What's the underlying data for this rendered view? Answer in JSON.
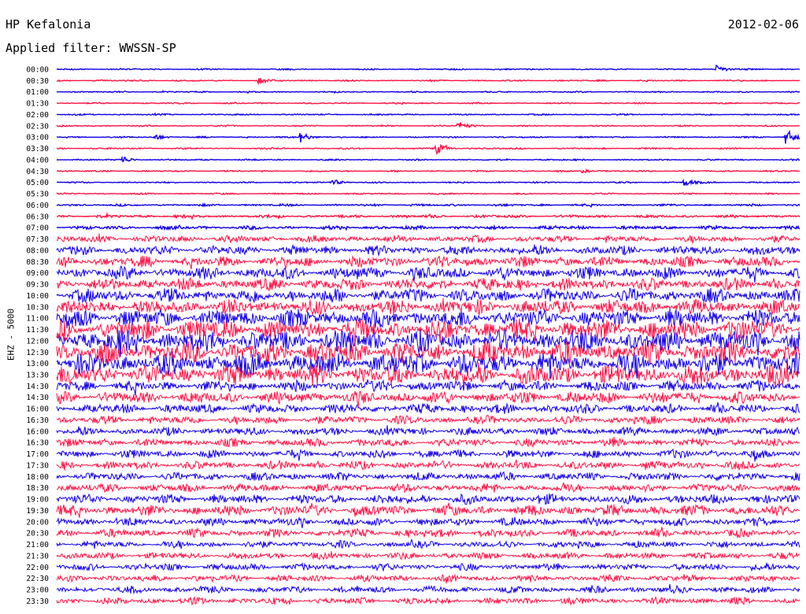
{
  "header": {
    "station": "HP Kefalonia",
    "date": "2012-02-06",
    "filter_label": "Applied filter: WWSSN-SP"
  },
  "colors": {
    "trace_a": "#1400e8",
    "trace_b": "#ff1447",
    "background": "#ffffff"
  },
  "chart_data": {
    "type": "line",
    "title": "HP Kefalonia",
    "ylabel": "EHZ - 5000",
    "xlabel": "",
    "y_tick_labels": [
      "00:00",
      "00:30",
      "01:00",
      "01:30",
      "02:00",
      "02:30",
      "03:00",
      "03:30",
      "04:00",
      "04:30",
      "05:00",
      "05:30",
      "06:00",
      "06:30",
      "07:00",
      "07:30",
      "08:00",
      "08:30",
      "09:00",
      "09:30",
      "10:00",
      "10:30",
      "11:00",
      "11:30",
      "12:00",
      "12:30",
      "13:00",
      "13:30",
      "14:00",
      "14:30",
      "15:00",
      "15:30",
      "16:00",
      "16:30",
      "17:00",
      "17:30",
      "18:00",
      "18:30",
      "19:00",
      "19:30",
      "20:00",
      "20:30",
      "21:00",
      "21:30",
      "22:00",
      "22:30",
      "23:00",
      "23:30"
    ],
    "tick_labels_shown": [
      "00:00",
      "00:30",
      "01:00",
      "01:30",
      "02:00",
      "02:30",
      "03:00",
      "03:30",
      "04:00",
      "04:30",
      "05:00",
      "05:30",
      "06:00",
      "06:30",
      "07:00",
      "07:30",
      "08:00",
      "08:30",
      "09:00",
      "09:30",
      "10:00",
      "10:30",
      "11:00",
      "11:30",
      "12:00",
      "12:30",
      "13:00",
      "13:30",
      "14:30",
      "14:30",
      "16:00",
      "16:30",
      "16:00",
      "16:30",
      "17:00",
      "17:30",
      "18:00",
      "18:30",
      "19:00",
      "19:30",
      "20:00",
      "20:30",
      "21:00",
      "21:30",
      "22:00",
      "22:30",
      "23:00",
      "23:30"
    ],
    "row_duration_minutes": 30,
    "series": [
      {
        "values": [
          1,
          1,
          1,
          1,
          1,
          1,
          1,
          1,
          1,
          1,
          1,
          1,
          1.5,
          2,
          2.5,
          5,
          7,
          8,
          9,
          9,
          10,
          11,
          13,
          15,
          16,
          16,
          16,
          15,
          8,
          9,
          7,
          6,
          6,
          6,
          6,
          6,
          6,
          6,
          7,
          8,
          6,
          6,
          5,
          5,
          5,
          5,
          5,
          5
        ]
      }
    ],
    "events": [
      {
        "time": "00:00",
        "minute": 26.7,
        "amplitude": 5
      },
      {
        "time": "00:30",
        "minute": 8.2,
        "amplitude": 3
      },
      {
        "time": "02:30",
        "minute": 16.3,
        "amplitude": 4
      },
      {
        "time": "03:00",
        "minute": 4.0,
        "amplitude": 3
      },
      {
        "time": "03:00",
        "minute": 9.9,
        "amplitude": 6
      },
      {
        "time": "03:00",
        "minute": 29.5,
        "amplitude": 9
      },
      {
        "time": "03:30",
        "minute": 15.4,
        "amplitude": 6
      },
      {
        "time": "04:00",
        "minute": 2.7,
        "amplitude": 4
      },
      {
        "time": "04:30",
        "minute": 21.3,
        "amplitude": 2
      },
      {
        "time": "05:00",
        "minute": 11.2,
        "amplitude": 3
      },
      {
        "time": "05:00",
        "minute": 25.4,
        "amplitude": 4
      }
    ],
    "grid": false,
    "legend": "none"
  }
}
